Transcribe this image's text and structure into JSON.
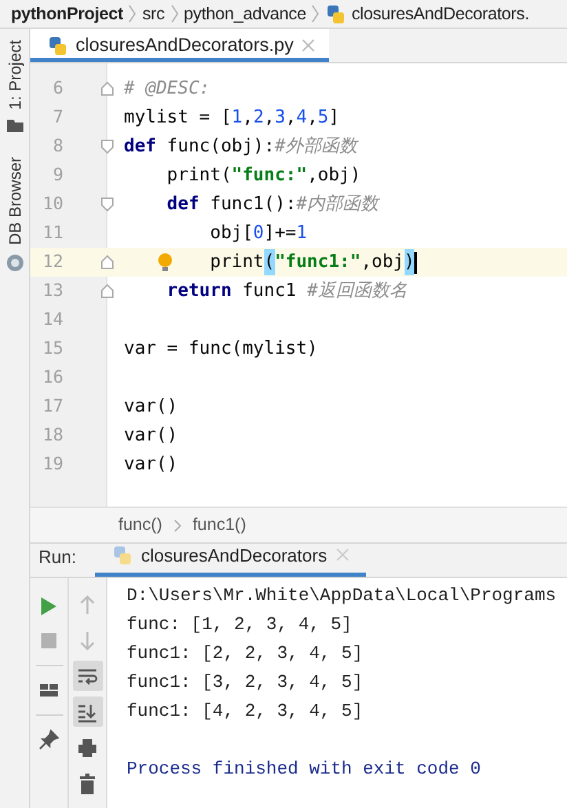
{
  "breadcrumb": [
    {
      "label": "pythonProject",
      "kind": "project"
    },
    {
      "label": "src",
      "kind": "folder"
    },
    {
      "label": "python_advance",
      "kind": "folder"
    },
    {
      "label": "closuresAndDecorators.",
      "kind": "file"
    }
  ],
  "side_tools": [
    {
      "label": "1: Project",
      "kind": "project"
    },
    {
      "label": "DB Browser",
      "kind": "db"
    }
  ],
  "editor_tabs": [
    {
      "label": "closuresAndDecorators.py",
      "selected": true
    }
  ],
  "code_lines": [
    {
      "number": "6",
      "fold_start": false,
      "fold_end": true,
      "current": false,
      "tokens": [
        {
          "text": "# @DESC:",
          "kind": "comment"
        }
      ]
    },
    {
      "number": "7",
      "fold_start": false,
      "fold_end": false,
      "current": false,
      "tokens": [
        {
          "text": "mylist = [",
          "kind": "plain"
        },
        {
          "text": "1",
          "kind": "number"
        },
        {
          "text": ",",
          "kind": "plain"
        },
        {
          "text": "2",
          "kind": "number"
        },
        {
          "text": ",",
          "kind": "plain"
        },
        {
          "text": "3",
          "kind": "number"
        },
        {
          "text": ",",
          "kind": "plain"
        },
        {
          "text": "4",
          "kind": "number"
        },
        {
          "text": ",",
          "kind": "plain"
        },
        {
          "text": "5",
          "kind": "number"
        },
        {
          "text": "]",
          "kind": "plain"
        }
      ]
    },
    {
      "number": "8",
      "fold_start": true,
      "fold_end": false,
      "current": false,
      "tokens": [
        {
          "text": "def",
          "kind": "keyword"
        },
        {
          "text": " func(obj):",
          "kind": "plain"
        },
        {
          "text": "#外部函数",
          "kind": "comment"
        }
      ]
    },
    {
      "number": "9",
      "fold_start": false,
      "fold_end": false,
      "current": false,
      "tokens": [
        {
          "text": "    print(",
          "kind": "plain"
        },
        {
          "text": "\"func:\"",
          "kind": "string"
        },
        {
          "text": ",obj)",
          "kind": "plain"
        }
      ]
    },
    {
      "number": "10",
      "fold_start": true,
      "fold_end": false,
      "current": false,
      "tokens": [
        {
          "text": "    def",
          "kind": "keyword"
        },
        {
          "text": " func1():",
          "kind": "plain"
        },
        {
          "text": "#内部函数",
          "kind": "comment"
        }
      ]
    },
    {
      "number": "11",
      "fold_start": false,
      "fold_end": false,
      "current": false,
      "tokens": [
        {
          "text": "        obj[",
          "kind": "plain"
        },
        {
          "text": "0",
          "kind": "number"
        },
        {
          "text": "]+=",
          "kind": "plain"
        },
        {
          "text": "1",
          "kind": "number"
        }
      ]
    },
    {
      "number": "12",
      "fold_start": false,
      "fold_end": true,
      "current": true,
      "tokens": [
        {
          "text": "        print",
          "kind": "plain"
        },
        {
          "text": "(",
          "kind": "match"
        },
        {
          "text": "\"func1:\"",
          "kind": "string"
        },
        {
          "text": ",obj",
          "kind": "plain"
        },
        {
          "text": ")",
          "kind": "match"
        }
      ]
    },
    {
      "number": "13",
      "fold_start": false,
      "fold_end": true,
      "current": false,
      "tokens": [
        {
          "text": "    return",
          "kind": "keyword"
        },
        {
          "text": " func1 ",
          "kind": "plain"
        },
        {
          "text": "#返回函数名",
          "kind": "comment"
        }
      ]
    },
    {
      "number": "14",
      "fold_start": false,
      "fold_end": false,
      "current": false
    },
    {
      "number": "15",
      "fold_start": false,
      "fold_end": false,
      "current": false,
      "tokens": [
        {
          "text": "var = func(mylist)",
          "kind": "plain"
        }
      ]
    },
    {
      "number": "16",
      "fold_start": false,
      "fold_end": false,
      "current": false
    },
    {
      "number": "17",
      "fold_start": false,
      "fold_end": false,
      "current": false,
      "tokens": [
        {
          "text": "var()",
          "kind": "plain"
        }
      ]
    },
    {
      "number": "18",
      "fold_start": false,
      "fold_end": false,
      "current": false,
      "tokens": [
        {
          "text": "var()",
          "kind": "plain"
        }
      ]
    },
    {
      "number": "19",
      "fold_start": false,
      "fold_end": false,
      "current": false,
      "tokens": [
        {
          "text": "var()",
          "kind": "plain"
        }
      ]
    }
  ],
  "structure_path": [
    "func()",
    "func1()"
  ],
  "run_panel": {
    "label": "Run:",
    "tabs": [
      {
        "label": "closuresAndDecorators",
        "selected": true
      }
    ],
    "left_tools": [
      {
        "kind": "run",
        "disabled": false
      },
      {
        "kind": "stop",
        "disabled": true
      },
      {
        "kind": "layout",
        "disabled": false
      },
      {
        "kind": "pin",
        "disabled": false
      }
    ],
    "right_tools": [
      {
        "kind": "up",
        "on": false
      },
      {
        "kind": "down",
        "on": false
      },
      {
        "kind": "wrap",
        "on": true
      },
      {
        "kind": "scroll-end",
        "on": true
      },
      {
        "kind": "print",
        "on": false
      },
      {
        "kind": "trash",
        "on": false
      }
    ],
    "console": [
      {
        "text": "D:\\Users\\Mr.White\\AppData\\Local\\Programs",
        "kind": "command"
      },
      {
        "text": "func: [1, 2, 3, 4, 5]",
        "kind": "output"
      },
      {
        "text": "func1: [2, 2, 3, 4, 5]",
        "kind": "output"
      },
      {
        "text": "func1: [3, 2, 3, 4, 5]",
        "kind": "output"
      },
      {
        "text": "func1: [4, 2, 3, 4, 5]",
        "kind": "output"
      },
      {
        "kind": "blank"
      },
      {
        "text": "Process finished with exit code 0",
        "kind": "system"
      }
    ]
  }
}
